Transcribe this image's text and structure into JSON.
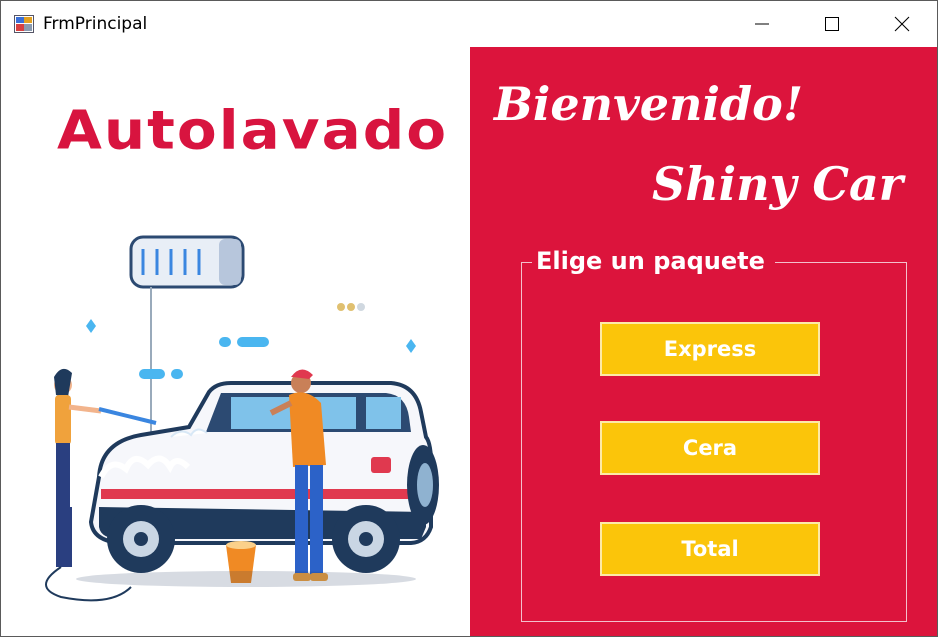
{
  "window": {
    "title": "FrmPrincipal",
    "icons": {
      "app": "app-icon",
      "minimize": "minimize-icon",
      "maximize": "maximize-icon",
      "close": "close-icon"
    }
  },
  "left_panel": {
    "logo_text": "Autolavado",
    "illustration": "car-wash-illustration"
  },
  "right_panel": {
    "welcome": "Bienvenido!",
    "brand": "Shiny Car",
    "group": {
      "legend": "Elige un paquete",
      "buttons": [
        "Express",
        "Cera",
        "Total"
      ]
    }
  },
  "colors": {
    "accent": "#dc143c",
    "button": "#fbc50a",
    "logo": "#d8143f"
  }
}
